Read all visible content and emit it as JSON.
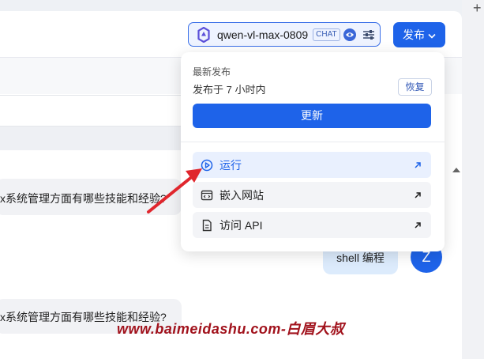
{
  "header": {
    "model_name": "qwen-vl-max-0809",
    "model_tag": "CHAT",
    "publish_label": "发布"
  },
  "dropdown": {
    "heading": "最新发布",
    "publish_time": "发布于 7 小时内",
    "restore_label": "恢复",
    "update_label": "更新",
    "items": [
      {
        "label": "运行",
        "icon": "play-circle-icon"
      },
      {
        "label": "嵌入网站",
        "icon": "embed-code-icon"
      },
      {
        "label": "访问 API",
        "icon": "document-icon"
      }
    ]
  },
  "chat": {
    "question_1": "x系统管理方面有哪些技能和经验?",
    "user_message": "shell 编程",
    "user_avatar_letter": "Z",
    "question_2": "x系统管理方面有哪些技能和经验?"
  },
  "watermark": "www.baimeidashu.com-白眉大叔",
  "colors": {
    "accent": "#1e63e9",
    "annotation": "#e0262d",
    "watermark": "#a1121c"
  }
}
